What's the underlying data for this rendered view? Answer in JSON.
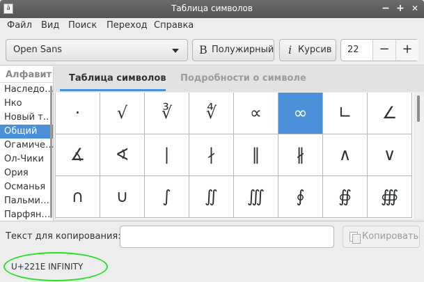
{
  "window": {
    "title": "Таблица символов",
    "app_icon_glyph": "ā",
    "minimize": "−",
    "maximize": "+",
    "close": "✕"
  },
  "menu": [
    "Файл",
    "Вид",
    "Поиск",
    "Переход",
    "Справка"
  ],
  "toolbar": {
    "font_name": "Open Sans",
    "bold_label": "Полужирный",
    "bold_icon_glyph": "B",
    "italic_label": "Курсив",
    "italic_icon_glyph": "i",
    "font_size": "22",
    "decrement": "−",
    "increment": "+"
  },
  "sidebar": {
    "header": "Алфавит",
    "items": [
      {
        "label": "Наследо…",
        "selected": false
      },
      {
        "label": "Нко",
        "selected": false
      },
      {
        "label": "Новый т…",
        "selected": false
      },
      {
        "label": "Общий",
        "selected": true
      },
      {
        "label": "Огамиче…",
        "selected": false
      },
      {
        "label": "Ол-Чики",
        "selected": false
      },
      {
        "label": "Ория",
        "selected": false
      },
      {
        "label": "Османья",
        "selected": false
      },
      {
        "label": "Пальми…",
        "selected": false
      },
      {
        "label": "Парфян…",
        "selected": false
      }
    ]
  },
  "tabs": [
    {
      "label": "Таблица символов",
      "active": true
    },
    {
      "label": "Подробности о символе",
      "active": false
    }
  ],
  "grid": {
    "rows": [
      [
        "·",
        "√",
        "∛",
        "∜",
        "∝",
        "∞",
        "∟",
        "∠"
      ],
      [
        "∡",
        "∢",
        "∣",
        "∤",
        "∥",
        "∦",
        "∧",
        "∨"
      ],
      [
        "∩",
        "∪",
        "∫",
        "∬",
        "∭",
        "∮",
        "∯",
        "∰"
      ]
    ],
    "selected": [
      0,
      5
    ]
  },
  "bottom": {
    "copy_label": "Текст для копирования:",
    "copy_value": "",
    "copy_button": "Копировать",
    "status": "U+221E INFINITY"
  },
  "colors": {
    "accent": "#4a90d9",
    "annotation": "#29e029"
  }
}
